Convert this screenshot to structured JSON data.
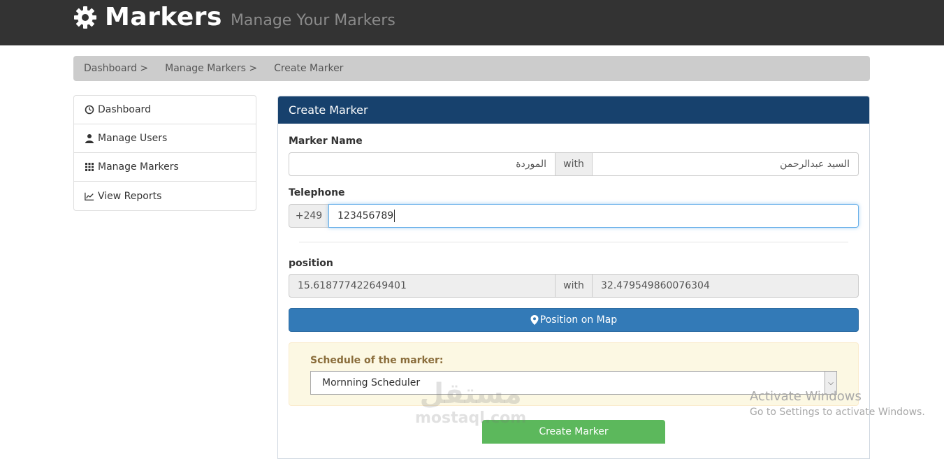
{
  "header": {
    "title": "Markers",
    "subtitle": "Manage Your Markers",
    "icon": "gear-icon"
  },
  "breadcrumb": {
    "items": [
      "Dashboard >",
      "Manage Markers >",
      "Create Marker"
    ]
  },
  "sidebar": {
    "items": [
      {
        "label": "Dashboard",
        "icon": "dashboard-icon"
      },
      {
        "label": "Manage Users",
        "icon": "user-icon"
      },
      {
        "label": "Manage Markers",
        "icon": "grid-icon"
      },
      {
        "label": "View Reports",
        "icon": "chart-icon"
      }
    ]
  },
  "form": {
    "panel_title": "Create Marker",
    "marker_name": {
      "label": "Marker Name",
      "value_first": "الموردة",
      "addon": "with",
      "value_second": "السيد عبدالرحمن"
    },
    "telephone": {
      "label": "Telephone",
      "prefix": "+249",
      "value": "123456789"
    },
    "position": {
      "label": "position",
      "lat": "15.618777422649401",
      "addon": "with",
      "lng": "32.479549860076304"
    },
    "map_button": "Position on Map",
    "schedule": {
      "label": "Schedule of the marker:",
      "selected": "Mornning Scheduler"
    },
    "submit_label": "Create Marker"
  },
  "watermark": {
    "arabic": "مستقل",
    "latin": "mostaql.com"
  },
  "os_notice": {
    "title": "Activate Windows",
    "detail": "Go to Settings to activate Windows."
  },
  "colors": {
    "topbar": "#333333",
    "panel_header": "#17416d",
    "primary": "#337ab7",
    "success": "#5cb85c",
    "warning_bg": "#fcf8e3"
  }
}
